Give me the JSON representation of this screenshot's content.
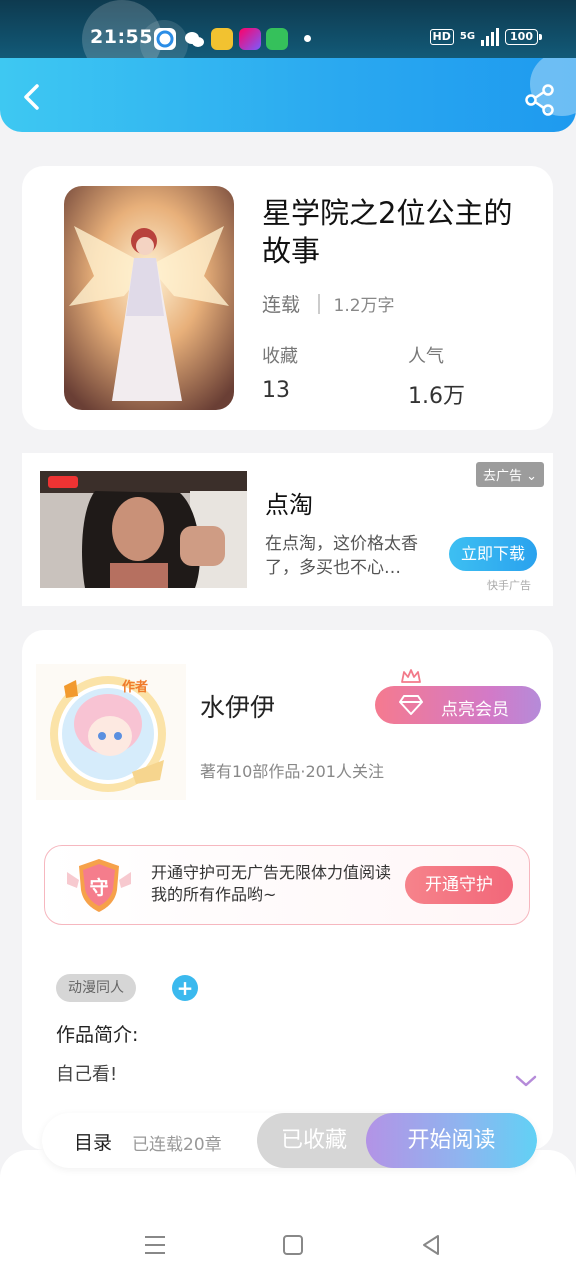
{
  "status_bar": {
    "time": "21:55",
    "hd": "HD",
    "network": "5G",
    "battery": "100"
  },
  "header": {
    "back_icon": "chevron-left-icon",
    "share_icon": "share-icon"
  },
  "book": {
    "title": "星学院之2位公主的故事",
    "status": "连载",
    "word_count": "1.2万字",
    "favorites_label": "收藏",
    "favorites_value": "13",
    "popularity_label": "人气",
    "popularity_value": "1.6万"
  },
  "ad": {
    "title": "点淘",
    "description": "在点淘，这价格太香了，多买也不心…",
    "remove_label": "去广告",
    "cta_label": "立即下载",
    "source": "快手广告"
  },
  "author": {
    "name": "水伊伊",
    "stats": "著有10部作品·201人关注",
    "badge_text": "作者",
    "vip_label": "点亮会员",
    "guard_text": "开通守护可无广告无限体力值阅读我的所有作品哟~",
    "guard_badge": "守",
    "guard_button": "开通守护"
  },
  "work": {
    "tag": "动漫同人",
    "add_tag": "+",
    "intro_label": "作品简介:",
    "intro_text": "自己看!"
  },
  "bottom_bar": {
    "toc_label": "目录",
    "chapters": "已连载20章",
    "collected_label": "已收藏",
    "read_label": "开始阅读"
  },
  "colors": {
    "accent": "#2aa8f0",
    "pink": "#f26779",
    "purple": "#b58bd9"
  }
}
